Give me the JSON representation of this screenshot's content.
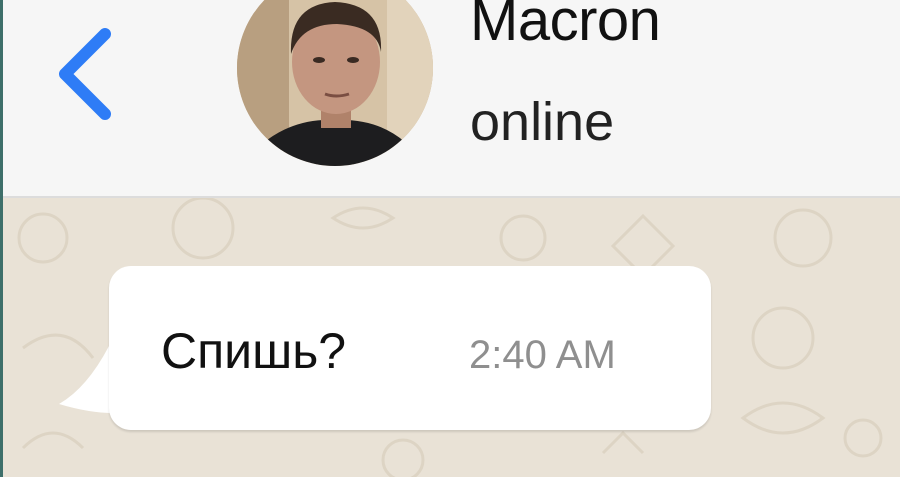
{
  "header": {
    "contact_name": "Macron",
    "status": "online",
    "back_icon": "chevron-left-icon",
    "accent_color": "#2e7cf6"
  },
  "messages": [
    {
      "text": "Спишь?",
      "time": "2:40 AM",
      "direction": "incoming"
    }
  ]
}
